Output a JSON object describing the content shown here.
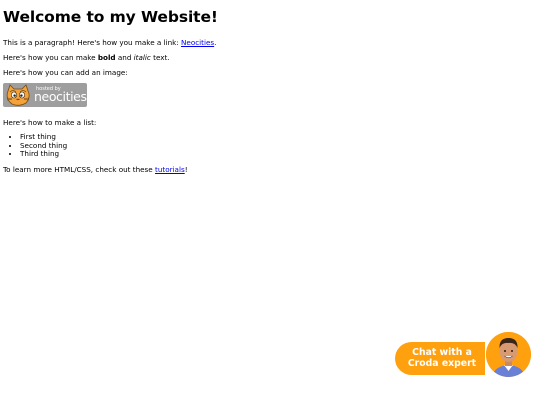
{
  "heading": "Welcome to my Website!",
  "paragraph_link": {
    "before": "This is a paragraph! Here's how you make a link: ",
    "link_text": "Neocities",
    "after": "."
  },
  "paragraph_format": {
    "before": "Here's how you can make ",
    "bold": "bold",
    "middle": " and ",
    "italic": "italic",
    "after": " text."
  },
  "paragraph_image": "Here's how you can add an image:",
  "badge": {
    "hosted_text": "hosted by",
    "brand_text": "neocities",
    "icon": "neocities-cat-icon"
  },
  "paragraph_list": "Here's how to make a list:",
  "list_items": [
    "First thing",
    "Second thing",
    "Third thing"
  ],
  "paragraph_learn": {
    "before": "To learn more HTML/CSS, check out these ",
    "link_text": "tutorials",
    "after": "!"
  },
  "chat_widget": {
    "line1": "Chat with a",
    "line2": "Croda expert",
    "color": "#ffa00f",
    "avatar_icon": "expert-avatar-icon"
  },
  "colors": {
    "link": "#0000ee",
    "badge_bg": "#9e9e9e",
    "chat_accent": "#ffa00f"
  }
}
